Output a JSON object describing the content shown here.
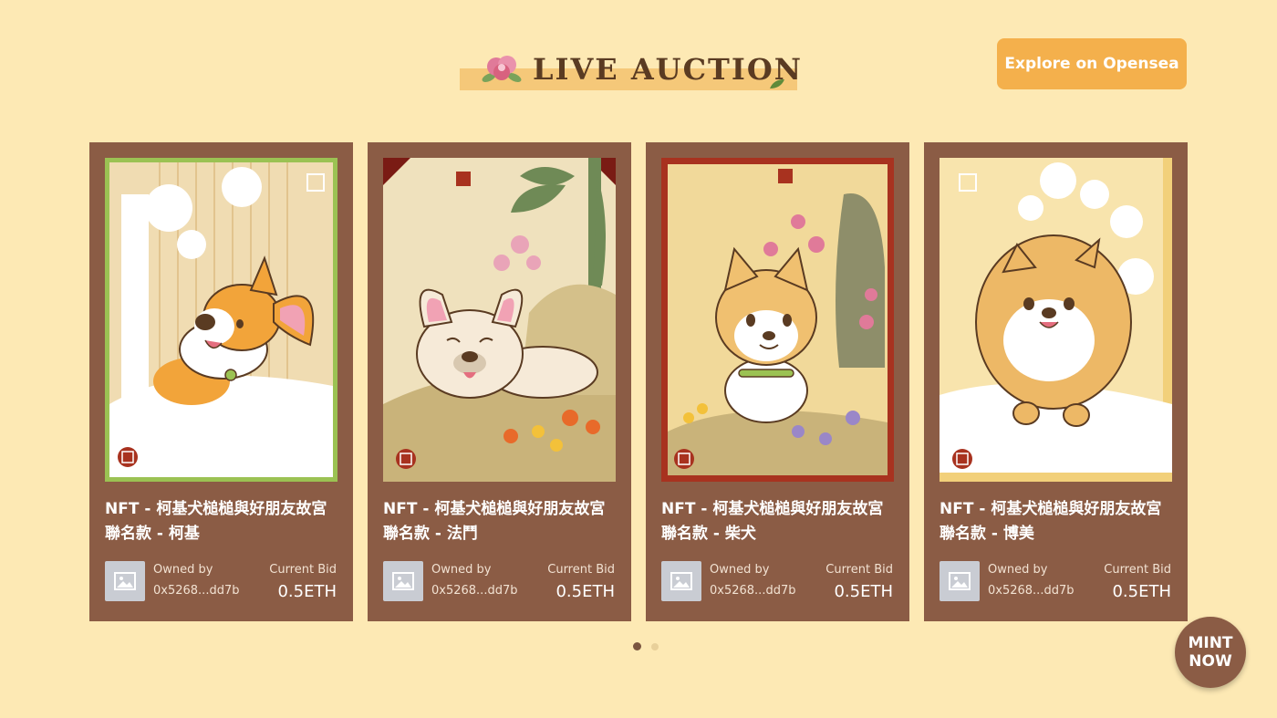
{
  "header": {
    "title": "LIVE AUCTION",
    "explore_label": "Explore on Opensea"
  },
  "cards": [
    {
      "title_line1": "NFT - 柯基犬槌槌與好朋友故宮",
      "title_line2": "聯名款 - 柯基",
      "owned_label": "Owned by",
      "owner": "0x5268...dd7b",
      "bid_label": "Current Bid",
      "bid": "0.5ETH",
      "colors": {
        "bg": "#f3e2c0",
        "frame": "#9bc253",
        "dog": "#f0a43a"
      }
    },
    {
      "title_line1": "NFT - 柯基犬槌槌與好朋友故宮",
      "title_line2": "聯名款 - 法鬥",
      "owned_label": "Owned by",
      "owner": "0x5268...dd7b",
      "bid_label": "Current Bid",
      "bid": "0.5ETH",
      "colors": {
        "bg": "#efe1bd",
        "frame": "#7a1b14",
        "dog": "#f6ead8"
      }
    },
    {
      "title_line1": "NFT - 柯基犬槌槌與好朋友故宮",
      "title_line2": "聯名款 - 柴犬",
      "owned_label": "Owned by",
      "owner": "0x5268...dd7b",
      "bid_label": "Current Bid",
      "bid": "0.5ETH",
      "colors": {
        "bg": "#f1d99a",
        "frame": "#a8321f",
        "dog": "#f0c070"
      }
    },
    {
      "title_line1": "NFT - 柯基犬槌槌與好朋友故宮",
      "title_line2": "聯名款 - 博美",
      "owned_label": "Owned by",
      "owner": "0x5268...dd7b",
      "bid_label": "Current Bid",
      "bid": "0.5ETH",
      "colors": {
        "bg": "#f8e4ad",
        "frame": "#f2d07a",
        "dog": "#edb866"
      }
    }
  ],
  "pagination": {
    "pages": 2,
    "current": 1
  },
  "mint": {
    "line1": "MINT",
    "line2": "NOW"
  },
  "colors": {
    "page_bg": "#fde9b4",
    "card_bg": "#8b5c45",
    "accent": "#f4b04c",
    "title_text": "#5a3b22"
  }
}
